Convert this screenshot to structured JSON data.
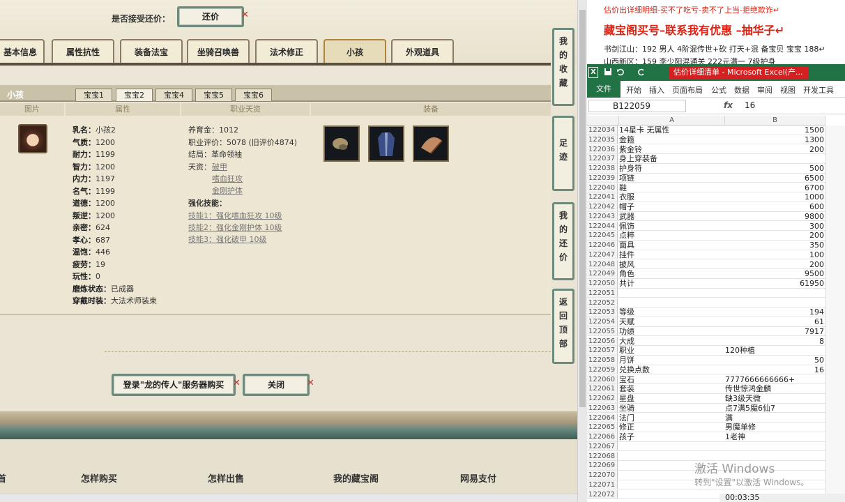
{
  "game": {
    "accept_label": "是否接受还价：",
    "counter_offer_button": "还价",
    "tabs": [
      "基本信息",
      "属性抗性",
      "装备法宝",
      "坐骑召唤兽",
      "法术修正",
      "小孩",
      "外观道具"
    ],
    "active_tab": "小孩",
    "section_title": "小孩",
    "subtabs": [
      "宝宝1",
      "宝宝2",
      "宝宝4",
      "宝宝5",
      "宝宝6"
    ],
    "active_subtab": "宝宝2",
    "columns": [
      "图片",
      "属性",
      "职业天资",
      "装备"
    ],
    "attrs_left": [
      {
        "label": "乳名：",
        "value": "小孩2"
      },
      {
        "label": "气质：",
        "value": "1200"
      },
      {
        "label": "耐力：",
        "value": "1199"
      },
      {
        "label": "智力：",
        "value": "1200"
      },
      {
        "label": "内力：",
        "value": "1197"
      },
      {
        "label": "名气：",
        "value": "1199"
      },
      {
        "label": "道德：",
        "value": "1200"
      },
      {
        "label": "叛逆：",
        "value": "1200"
      },
      {
        "label": "亲密：",
        "value": "624"
      },
      {
        "label": "孝心：",
        "value": "687"
      },
      {
        "label": "温饱：",
        "value": "446"
      },
      {
        "label": "疲劳：",
        "value": "19"
      },
      {
        "label": "玩性：",
        "value": "0"
      },
      {
        "label": "磨炼状态：",
        "value": "已成器"
      },
      {
        "label": "穿戴时装：",
        "value": "大法术师装束"
      }
    ],
    "attrs_mid": {
      "raise_fee": "养育金：1012",
      "career_rating": "职业评价：5078 (旧评价4874)",
      "ending": "结局：革命领袖",
      "talent_label": "天资：",
      "talents": [
        "破甲",
        "嗜血狂攻",
        "金刚护体"
      ],
      "enhance_label": "强化技能：",
      "skills": [
        "技能1：强化嗜血狂攻 10级",
        "技能2：强化金刚护体 10级",
        "技能3：强化破甲 10级"
      ]
    },
    "equip_count": 3,
    "buy_button": "登录\"龙的传人\"服务器购买",
    "close_button": "关闭",
    "footer": [
      "首",
      "怎样购买",
      "怎样出售",
      "我的藏宝阁",
      "网易支付"
    ],
    "side_buttons": [
      "我的收藏",
      "足迹",
      "我的还价",
      "返回顶部"
    ]
  },
  "excel": {
    "doc_lines": [
      "估价出详细明细-买不了吃亏-卖不了上当-拒绝欺诈↵",
      "藏宝阁买号–联系我有优惠 –抽华子↵",
      "书剑江山：192 男人 4阶混传世+砍 打天+混 备宝贝 宝宝 188↵",
      "山西新区：159 李少阳混通关 222元满一 7级护身"
    ],
    "window_title": "估价详细清单 - Microsoft Excel(产...",
    "menu_file": "文件",
    "menu_items": [
      "开始",
      "插入",
      "页面布局",
      "公式",
      "数据",
      "审阅",
      "视图",
      "开发工具"
    ],
    "name_box": "B122059",
    "fx": "fx",
    "formula_value": "16",
    "col_a": "A",
    "col_b": "B",
    "rows": [
      {
        "n": "122034",
        "a": "14星卡 无属性",
        "b": "1500",
        "num": true
      },
      {
        "n": "122035",
        "a": "金箍",
        "b": "1300",
        "num": true
      },
      {
        "n": "122036",
        "a": "紫金铃",
        "b": "200",
        "num": true
      },
      {
        "n": "122037",
        "a": "身上穿装备",
        "b": "",
        "num": true
      },
      {
        "n": "122038",
        "a": "护身符",
        "b": "500",
        "num": true
      },
      {
        "n": "122039",
        "a": "项链",
        "b": "6500",
        "num": true
      },
      {
        "n": "122040",
        "a": "鞋",
        "b": "6700",
        "num": true
      },
      {
        "n": "122041",
        "a": "衣服",
        "b": "1000",
        "num": true
      },
      {
        "n": "122042",
        "a": "帽子",
        "b": "600",
        "num": true
      },
      {
        "n": "122043",
        "a": "武器",
        "b": "9800",
        "num": true
      },
      {
        "n": "122044",
        "a": "佩饰",
        "b": "300",
        "num": true
      },
      {
        "n": "122045",
        "a": "点粹",
        "b": "200",
        "num": true
      },
      {
        "n": "122046",
        "a": "面具",
        "b": "350",
        "num": true
      },
      {
        "n": "122047",
        "a": "挂件",
        "b": "100",
        "num": true
      },
      {
        "n": "122048",
        "a": "披风",
        "b": "200",
        "num": true
      },
      {
        "n": "122049",
        "a": "角色",
        "b": "9500",
        "num": true
      },
      {
        "n": "122050",
        "a": "共计",
        "b": "61950",
        "num": true
      },
      {
        "n": "122051",
        "a": "",
        "b": "",
        "num": true
      },
      {
        "n": "122052",
        "a": "",
        "b": "",
        "num": true
      },
      {
        "n": "122053",
        "a": "等级",
        "b": "194",
        "num": true
      },
      {
        "n": "122054",
        "a": "天赋",
        "b": "61",
        "num": true
      },
      {
        "n": "122055",
        "a": "功绩",
        "b": "7917",
        "num": true
      },
      {
        "n": "122056",
        "a": "大成",
        "b": "8",
        "num": true
      },
      {
        "n": "122057",
        "a": "职业",
        "b": "120种植",
        "num": false
      },
      {
        "n": "122058",
        "a": "月饼",
        "b": "50",
        "num": true
      },
      {
        "n": "122059",
        "a": "兑换点数",
        "b": "16",
        "num": true
      },
      {
        "n": "122060",
        "a": "宝石",
        "b": "7777666666666+",
        "num": false
      },
      {
        "n": "122061",
        "a": "套装",
        "b": "传世惊鸿金麟",
        "num": false
      },
      {
        "n": "122062",
        "a": "星盘",
        "b": "缺3级天微",
        "num": false
      },
      {
        "n": "122063",
        "a": "坐骑",
        "b": "点7满5魔6仙7",
        "num": false
      },
      {
        "n": "122064",
        "a": "法门",
        "b": "满",
        "num": false
      },
      {
        "n": "122065",
        "a": "修正",
        "b": "男魔单修",
        "num": false
      },
      {
        "n": "122066",
        "a": "孩子",
        "b": "1老神",
        "num": false
      },
      {
        "n": "122067",
        "a": "",
        "b": "",
        "num": true
      },
      {
        "n": "122068",
        "a": "",
        "b": "",
        "num": true
      },
      {
        "n": "122069",
        "a": "",
        "b": "",
        "num": true
      },
      {
        "n": "122070",
        "a": "",
        "b": "",
        "num": true
      },
      {
        "n": "122071",
        "a": "",
        "b": "",
        "num": true
      },
      {
        "n": "122072",
        "a": "",
        "b": "",
        "num": true
      }
    ],
    "watermark_title": "激活 Windows",
    "watermark_sub": "转到\"设置\"以激活 Windows。",
    "timer": "00:03:35"
  },
  "colors": {
    "excel_green": "#217346",
    "title_red": "#d42020",
    "frame_green": "#6e8a7c",
    "doc_red": "#e02010"
  }
}
